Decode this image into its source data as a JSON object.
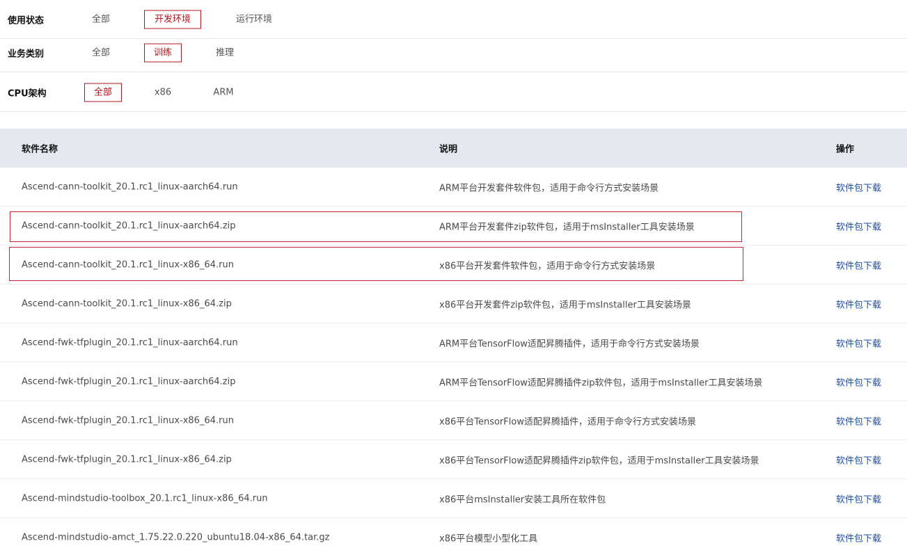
{
  "filters": [
    {
      "label": "使用状态",
      "options": [
        "全部",
        "开发环境",
        "运行环境"
      ],
      "selected": 1
    },
    {
      "label": "业务类别",
      "options": [
        "全部",
        "训练",
        "推理"
      ],
      "selected": 1
    },
    {
      "label": "CPU架构",
      "options": [
        "全部",
        "x86",
        "ARM"
      ],
      "selected": 0
    }
  ],
  "table": {
    "headers": [
      "软件名称",
      "说明",
      "操作"
    ],
    "download_label": "软件包下载",
    "rows": [
      {
        "name": "Ascend-cann-toolkit_20.1.rc1_linux-aarch64.run",
        "desc": "ARM平台开发套件软件包，适用于命令行方式安装场景"
      },
      {
        "name": "Ascend-cann-toolkit_20.1.rc1_linux-aarch64.zip",
        "desc": "ARM平台开发套件zip软件包，适用于msInstaller工具安装场景"
      },
      {
        "name": "Ascend-cann-toolkit_20.1.rc1_linux-x86_64.run",
        "desc": "x86平台开发套件软件包，适用于命令行方式安装场景"
      },
      {
        "name": "Ascend-cann-toolkit_20.1.rc1_linux-x86_64.zip",
        "desc": "x86平台开发套件zip软件包，适用于msInstaller工具安装场景"
      },
      {
        "name": "Ascend-fwk-tfplugin_20.1.rc1_linux-aarch64.run",
        "desc": "ARM平台TensorFlow适配昇腾插件，适用于命令行方式安装场景"
      },
      {
        "name": "Ascend-fwk-tfplugin_20.1.rc1_linux-aarch64.zip",
        "desc": "ARM平台TensorFlow适配昇腾插件zip软件包，适用于msInstaller工具安装场景"
      },
      {
        "name": "Ascend-fwk-tfplugin_20.1.rc1_linux-x86_64.run",
        "desc": "x86平台TensorFlow适配昇腾插件，适用于命令行方式安装场景"
      },
      {
        "name": "Ascend-fwk-tfplugin_20.1.rc1_linux-x86_64.zip",
        "desc": "x86平台TensorFlow适配昇腾插件zip软件包，适用于msInstaller工具安装场景"
      },
      {
        "name": "Ascend-mindstudio-toolbox_20.1.rc1_linux-x86_64.run",
        "desc": "x86平台msInstaller安装工具所在软件包"
      },
      {
        "name": "Ascend-mindstudio-amct_1.75.22.0.220_ubuntu18.04-x86_64.tar.gz",
        "desc": "x86平台模型小型化工具"
      }
    ],
    "highlighted_rows": [
      1,
      2
    ]
  },
  "colors": {
    "accent": "#b5121b",
    "link": "#1f4e9e",
    "header_bg": "#e4e8f1"
  }
}
